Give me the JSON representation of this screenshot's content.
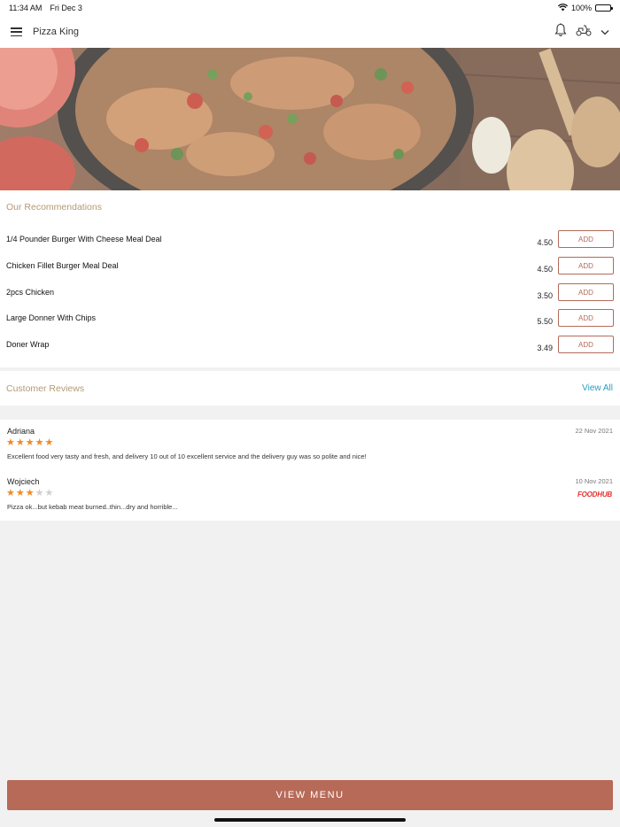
{
  "status": {
    "time": "11:34 AM",
    "date": "Fri Dec 3",
    "battery": "100%"
  },
  "nav": {
    "title": "Pizza King"
  },
  "recommendations": {
    "title": "Our Recommendations",
    "add_label": "ADD",
    "items": [
      {
        "name": "1/4 Pounder Burger With Cheese Meal Deal",
        "price": "4.50"
      },
      {
        "name": "Chicken Fillet Burger Meal Deal",
        "price": "4.50"
      },
      {
        "name": "2pcs Chicken",
        "price": "3.50"
      },
      {
        "name": "Large Donner With Chips",
        "price": "5.50"
      },
      {
        "name": "Doner Wrap",
        "price": "3.49"
      }
    ]
  },
  "reviews": {
    "title": "Customer Reviews",
    "view_all": "View All",
    "items": [
      {
        "name": "Adriana",
        "date": "22 Nov 2021",
        "rating": 5,
        "text": "Excellent food very tasty and fresh, and delivery 10 out of 10 excellent service and the delivery guy was so polite and nice!"
      },
      {
        "name": "Wojciech",
        "date": "10 Nov 2021",
        "rating": 3,
        "text": "Pizza ok...but kebab meat burned..thin...dry and horrible...",
        "source": "FOODHUB"
      }
    ]
  },
  "footer": {
    "view_menu": "VIEW MENU"
  },
  "colors": {
    "accent": "#b76a58",
    "section_title": "#b39a74",
    "link": "#2a9dc1",
    "star": "#f08a24"
  }
}
